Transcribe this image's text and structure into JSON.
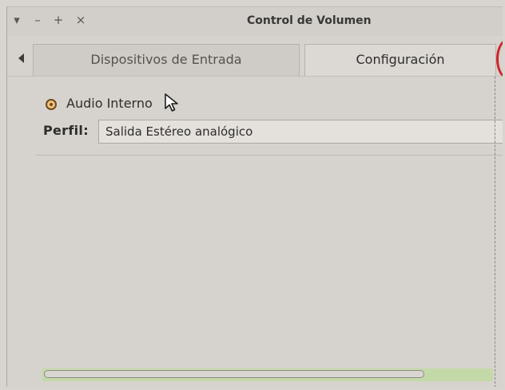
{
  "window": {
    "title": "Control de Volumen",
    "controls": {
      "menu_glyph": "▾",
      "minimize_glyph": "–",
      "maximize_glyph": "+",
      "close_glyph": "×"
    }
  },
  "tabs": {
    "scroll_left_icon": "triangle-left",
    "items": [
      {
        "label": "Dispositivos de Entrada",
        "active": false
      },
      {
        "label": "Configuración",
        "active": true
      }
    ]
  },
  "device": {
    "label": "Audio Interno",
    "selected": true
  },
  "profile": {
    "label": "Perfil:",
    "value": "Salida Estéreo analógico"
  },
  "scrollbar": {
    "position_fraction": 0.85
  },
  "colors": {
    "accent_scroll_track": "#c4d9a8",
    "radio_fill": "#f2c37a",
    "annotation_mark": "#d2232a"
  }
}
